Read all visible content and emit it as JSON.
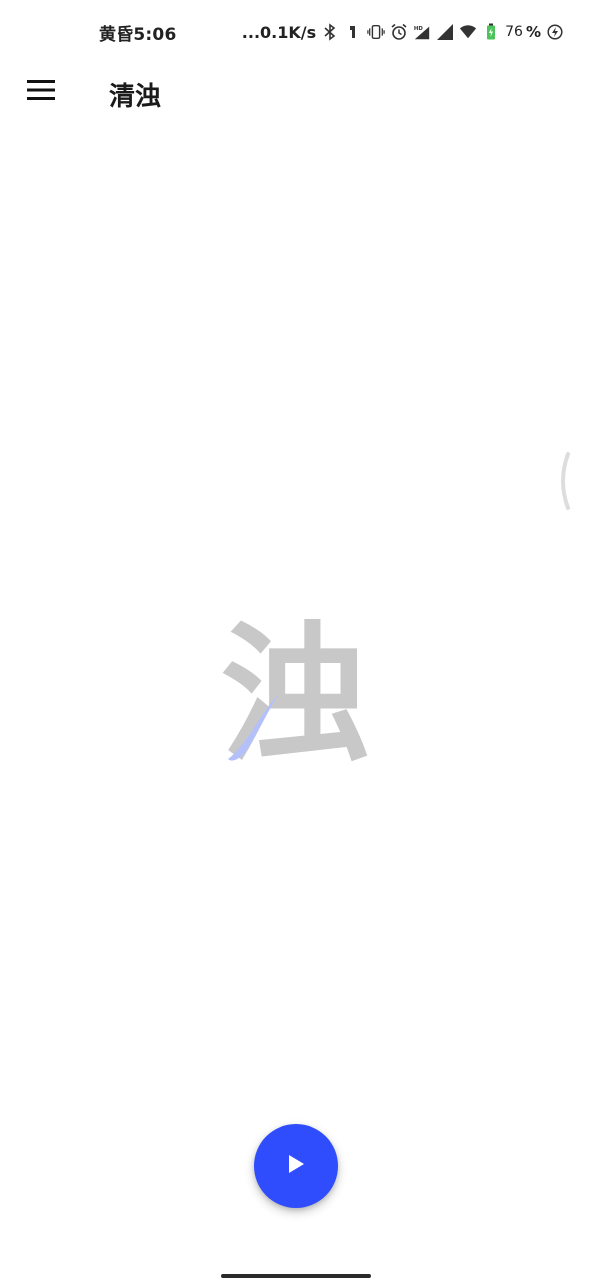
{
  "status_bar": {
    "time": "黄昏5:06",
    "network_speed": "...0.1K/s",
    "battery_level": "76",
    "battery_percent_sign": "%",
    "icons": [
      "bluetooth-icon",
      "headset-icon",
      "vibrate-icon",
      "alarm-icon",
      "hd-signal-icon",
      "signal-icon",
      "wifi-icon",
      "battery-icon",
      "charging-icon"
    ]
  },
  "app_bar": {
    "title": "清浊",
    "menu_icon": "hamburger-menu-icon"
  },
  "center": {
    "character": "浊",
    "character_color": "#c8c8c8",
    "stroke_highlight_color": "#b4c0fb"
  },
  "fab": {
    "icon": "play-icon",
    "color": "#2f4dfc"
  }
}
